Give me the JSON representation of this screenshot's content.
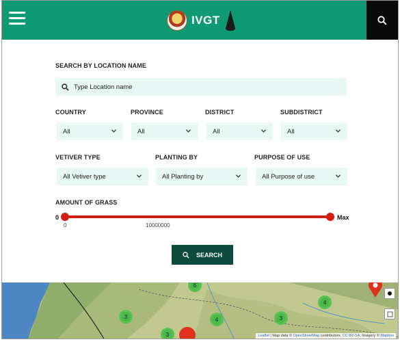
{
  "header": {
    "brand": "IVGT",
    "menu_icon": "hamburger-menu-icon",
    "search_icon": "search-icon",
    "bg_color": "#0f9a73"
  },
  "form": {
    "search_label": "SEARCH BY LOCATION NAME",
    "search_placeholder": "Type Location name",
    "country": {
      "label": "COUNTRY",
      "value": "All"
    },
    "province": {
      "label": "PROVINCE",
      "value": "All"
    },
    "district": {
      "label": "DISTRICT",
      "value": "All"
    },
    "subdistrict": {
      "label": "SUBDISTRICT",
      "value": "All"
    },
    "vetiver_type": {
      "label": "VETIVER TYPE",
      "value": "All Vetiver type"
    },
    "planting_by": {
      "label": "PLANTING BY",
      "value": "All Planting by"
    },
    "purpose_of_use": {
      "label": "PURPOSE OF USE",
      "value": "All Purpose of use"
    },
    "grass": {
      "label": "AMOUNT OF GRASS",
      "min_label": "0",
      "max_label": "Max",
      "tick_min": "0",
      "tick_mid": "10000000",
      "slider_color": "#cc1f12"
    },
    "search_button": "SEARCH",
    "button_color": "#0c4a3b"
  },
  "map": {
    "clusters": [
      "6",
      "3",
      "4",
      "3",
      "4",
      "3"
    ],
    "attribution": {
      "leaflet": "Leaflet",
      "text1": " | Map data © ",
      "osm": "OpenStreetMap",
      "text2": " contributors, ",
      "ccbysa": "CC-BY-SA",
      "text3": ", Imagery © ",
      "mapbox": "Mapbox"
    }
  }
}
